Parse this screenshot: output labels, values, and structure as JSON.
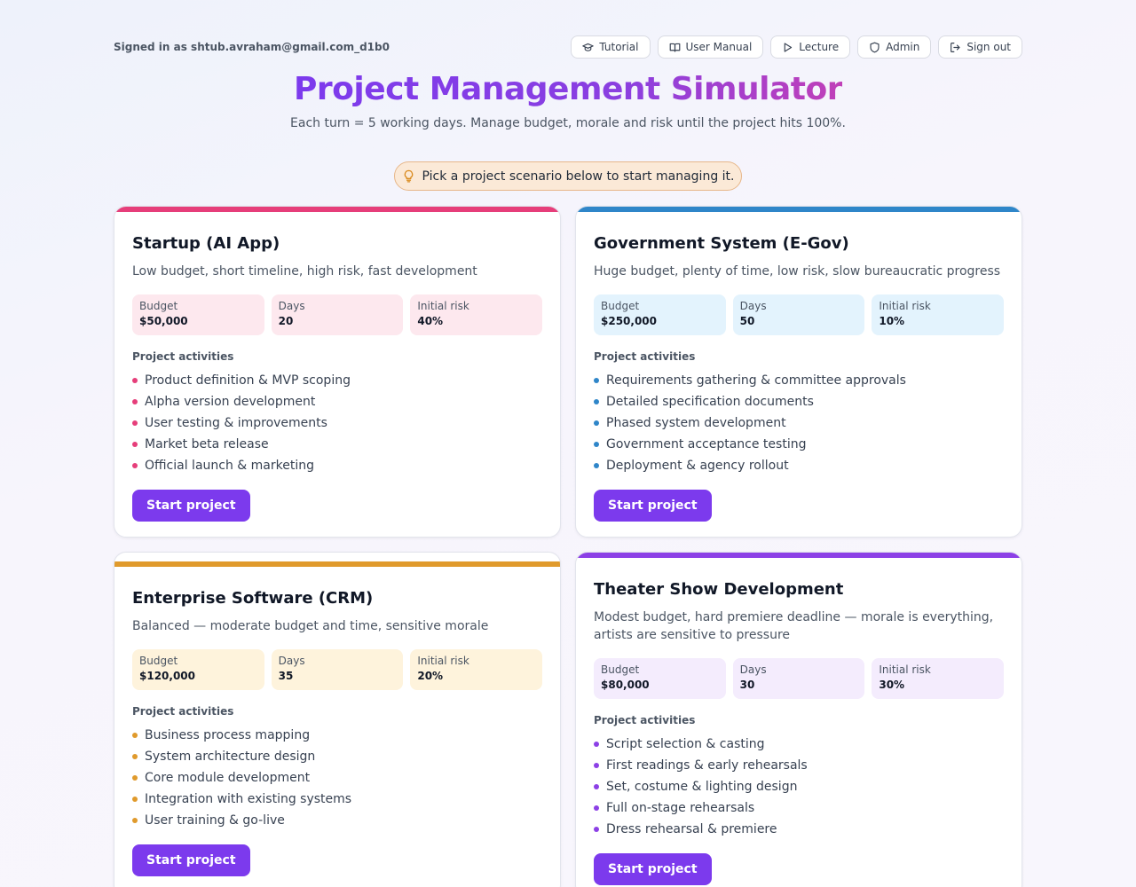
{
  "header": {
    "signed_in": "Signed in as shtub.avraham@gmail.com_d1b0",
    "nav": [
      {
        "label": "Tutorial",
        "icon": "graduation-cap-icon"
      },
      {
        "label": "User Manual",
        "icon": "book-icon"
      },
      {
        "label": "Lecture",
        "icon": "play-icon"
      },
      {
        "label": "Admin",
        "icon": "shield-icon"
      },
      {
        "label": "Sign out",
        "icon": "sign-out-icon"
      }
    ]
  },
  "page": {
    "title": "Project Management Simulator",
    "subtitle": "Each turn = 5 working days. Manage budget, morale and risk until the project hits 100%.",
    "hint": "Pick a project scenario below to start managing it."
  },
  "scenarios": [
    {
      "title": "Startup (AI App)",
      "description": "Low budget, short timeline, high risk, fast development",
      "accent": "#e63e7a",
      "tint": "#fde8ee",
      "stats": [
        {
          "label": "Budget",
          "value": "$50,000"
        },
        {
          "label": "Days",
          "value": "20"
        },
        {
          "label": "Initial risk",
          "value": "40%"
        }
      ],
      "activities_heading": "Project activities",
      "activities": [
        "Product definition & MVP scoping",
        "Alpha version development",
        "User testing & improvements",
        "Market beta release",
        "Official launch & marketing"
      ],
      "button": "Start project"
    },
    {
      "title": "Government System (E-Gov)",
      "description": "Huge budget, plenty of time, low risk, slow bureaucratic progress",
      "accent": "#2f86c9",
      "tint": "#e3f3fd",
      "stats": [
        {
          "label": "Budget",
          "value": "$250,000"
        },
        {
          "label": "Days",
          "value": "50"
        },
        {
          "label": "Initial risk",
          "value": "10%"
        }
      ],
      "activities_heading": "Project activities",
      "activities": [
        "Requirements gathering & committee approvals",
        "Detailed specification documents",
        "Phased system development",
        "Government acceptance testing",
        "Deployment & agency rollout"
      ],
      "button": "Start project"
    },
    {
      "title": "Enterprise Software (CRM)",
      "description": "Balanced — moderate budget and time, sensitive morale",
      "accent": "#e09a2c",
      "tint": "#fef3dc",
      "stats": [
        {
          "label": "Budget",
          "value": "$120,000"
        },
        {
          "label": "Days",
          "value": "35"
        },
        {
          "label": "Initial risk",
          "value": "20%"
        }
      ],
      "activities_heading": "Project activities",
      "activities": [
        "Business process mapping",
        "System architecture design",
        "Core module development",
        "Integration with existing systems",
        "User training & go-live"
      ],
      "button": "Start project"
    },
    {
      "title": "Theater Show Development",
      "description": "Modest budget, hard premiere deadline — morale is everything, artists are sensitive to pressure",
      "accent": "#8c40e6",
      "tint": "#f4ecfd",
      "stats": [
        {
          "label": "Budget",
          "value": "$80,000"
        },
        {
          "label": "Days",
          "value": "30"
        },
        {
          "label": "Initial risk",
          "value": "30%"
        }
      ],
      "activities_heading": "Project activities",
      "activities": [
        "Script selection & casting",
        "First readings & early rehearsals",
        "Set, costume & lighting design",
        "Full on-stage rehearsals",
        "Dress rehearsal & premiere"
      ],
      "button": "Start project"
    }
  ]
}
